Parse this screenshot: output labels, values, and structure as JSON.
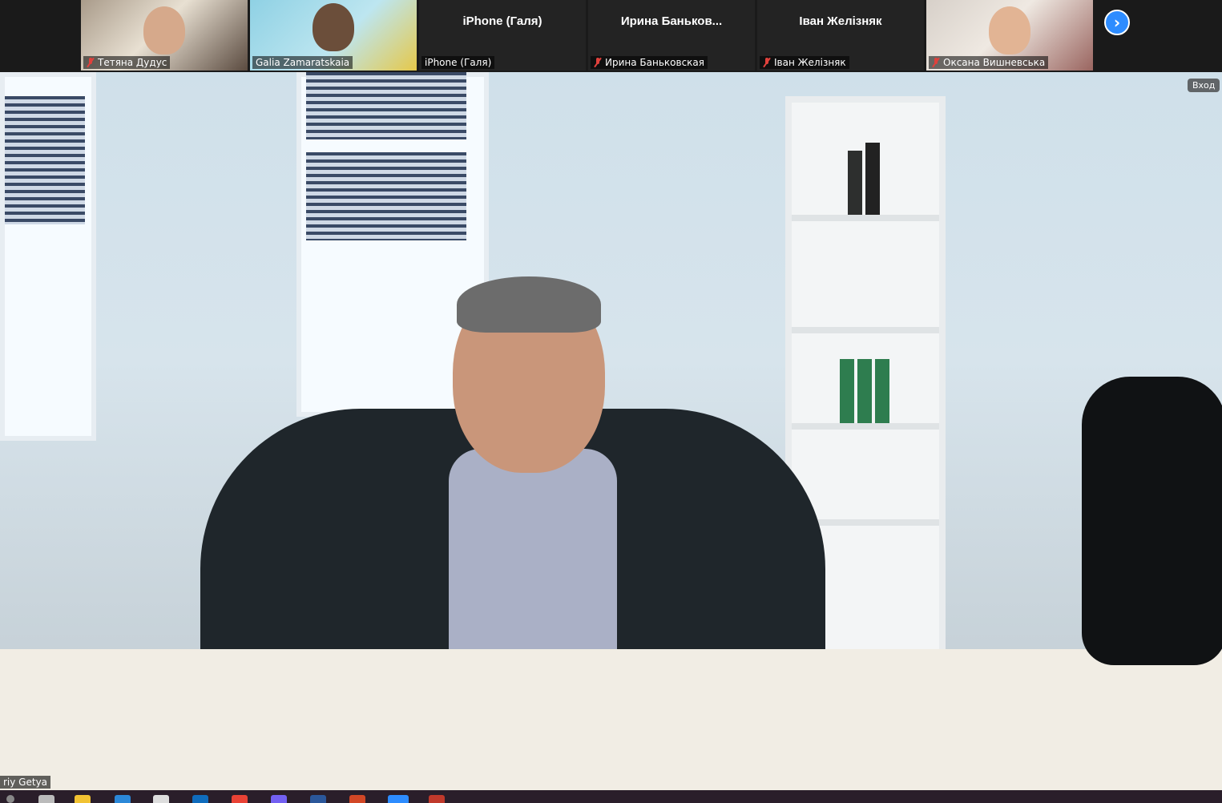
{
  "gallery": {
    "participants": [
      {
        "caption": "Тетяна Дудус",
        "muted": true,
        "type": "video"
      },
      {
        "caption": "Galia Zamaratskaia",
        "muted": false,
        "type": "video"
      },
      {
        "display_name": "iPhone (Галя)",
        "caption": "iPhone (Галя)",
        "muted": false,
        "type": "name"
      },
      {
        "display_name": "Ирина  Баньков...",
        "caption": "Ирина Баньковская",
        "muted": true,
        "type": "name"
      },
      {
        "display_name": "Іван Желізняк",
        "caption": "Іван Желізняк",
        "muted": true,
        "type": "name"
      },
      {
        "caption": "Оксана Вишневська",
        "muted": true,
        "type": "video"
      }
    ],
    "next_icon": "chevron-right-icon",
    "accent_color": "#2d8cff"
  },
  "speaker": {
    "name_tag": "riy Getya",
    "enter_label": "Вход"
  },
  "taskbar": {
    "icons": [
      "search-icon",
      "task-view-icon",
      "file-explorer-icon",
      "edge-icon",
      "app-icon",
      "outlook-icon",
      "chrome-icon",
      "viber-icon",
      "word-icon",
      "powerpoint-icon",
      "zoom-icon",
      "app-icon"
    ]
  }
}
